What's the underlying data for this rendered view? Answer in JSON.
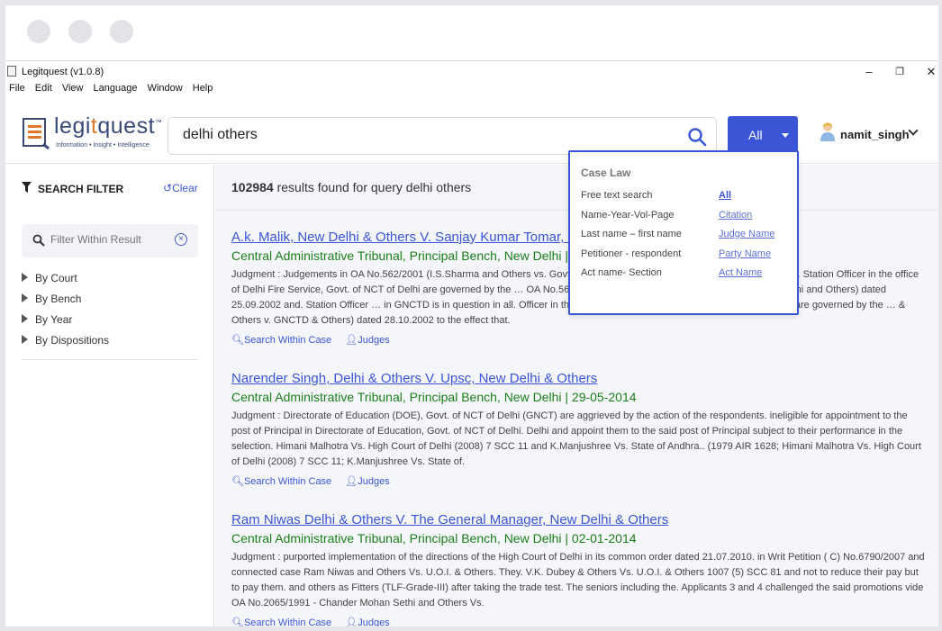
{
  "window": {
    "title": "Legitquest (v1.0.8)",
    "controls": {
      "minimize": "–",
      "restore": "❐",
      "close": "✕"
    }
  },
  "menu": [
    "File",
    "Edit",
    "View",
    "Language",
    "Window",
    "Help"
  ],
  "logo": {
    "brand_pre": "legi",
    "brand_i": "t",
    "brand_post": "quest",
    "tm": "™",
    "tagline": "Information • Insight • Intelligence"
  },
  "search": {
    "value": "delhi others",
    "icon": "search-icon"
  },
  "scope_button": {
    "label": "All"
  },
  "user": {
    "name": "namit_singh"
  },
  "sidebar": {
    "title": "SEARCH FILTER",
    "clear_label": "Clear",
    "filter_placeholder": "Filter Within Result",
    "filters": [
      "By Court",
      "By Bench",
      "By Year",
      "By Dispositions"
    ]
  },
  "results_summary": {
    "count": "102984",
    "text": " results found for query delhi others"
  },
  "results": [
    {
      "title": "A.k. Malik, New Delhi & Others V. Sanjay Kumar Tomar, New ",
      "court": "Central Administrative Tribunal, Principal Bench, New Delhi | 09-01-2",
      "text": "Judgment : Judgements in OA No.562/2001 (I.S.Sharma and Others vs. Govt. of NCT of Delhi and Others) dated 25.09.2002 and. Station Officer in the office of Delhi Fire Service, Govt. of NCT of Delhi are governed by the … OA No.562/2001 (I.S.Sharma & Others v. Govt. of NCT of Delhi and Others) dated 25.09.2002 and. Station Officer … in GNCTD is in question in all. Officer in the office of Delhi Fire Service, Govt. of NCT of Delhi are governed by the … & Others v. GNCTD & Others) dated 28.10.2002 to the effect that.",
      "links": [
        "Search Within Case",
        "Judges"
      ]
    },
    {
      "title": "Narender Singh, Delhi & Others V. Upsc, New Delhi & Others ",
      "court": "Central Administrative Tribunal, Principal Bench, New Delhi | 29-05-2014",
      "text": "Judgment : Directorate of Education (DOE), Govt. of NCT of Delhi (GNCT) are aggrieved by the action of the respondents. ineligible for appointment to the post of Principal in Directorate of Education, Govt. of NCT of Delhi. Delhi and appoint them to the said post of Principal subject to their performance in the selection. Himani Malhotra Vs. High Court of Delhi (2008) 7 SCC 11 and K.Manjushree Vs. State of Andhra.. (1979 AIR 1628; Himani Malhotra Vs. High Court of Delhi (2008) 7 SCC 11; K.Manjushree Vs. State of.",
      "links": [
        "Search Within Case",
        "Judges"
      ]
    },
    {
      "title": "Ram Niwas Delhi & Others V. The General Manager, New Delhi & Others ",
      "court": "Central Administrative Tribunal, Principal Bench, New Delhi | 02-01-2014",
      "text": "Judgment : purported implementation of the directions of the High Court of Delhi in its common order dated 21.07.2010. in Writ Petition ( C) No.6790/2007 and connected case Ram Niwas and Others Vs. U.O.I. & Others. They. V.K. Dubey & Others Vs. U.O.I. & Others 1007 (5) SCC 81 and not to reduce their pay but to pay them. and others as Fitters (TLF-Grade-III) after taking the trade test. The seniors including the. Applicants 3 and 4 challenged the said promotions vide OA No.2065/1991 - Chander Mohan Sethi and Others Vs.",
      "links": [
        "Search Within Case",
        "Judges"
      ]
    }
  ],
  "dropdown": {
    "title": "Case Law",
    "rows": [
      {
        "hint": "Free text search",
        "option": "All"
      },
      {
        "hint": "Name-Year-Vol-Page",
        "option": "Citation"
      },
      {
        "hint": "Last name – first name",
        "option": "Judge Name"
      },
      {
        "hint": "Petitioner - respondent",
        "option": "Party Name"
      },
      {
        "hint": "Act name- Section",
        "option": "Act Name"
      }
    ]
  },
  "colors": {
    "accent": "#3a55d6",
    "court_green": "#1a7f1a",
    "brand": "#3a4a77",
    "brand_orange": "#e0772b"
  }
}
